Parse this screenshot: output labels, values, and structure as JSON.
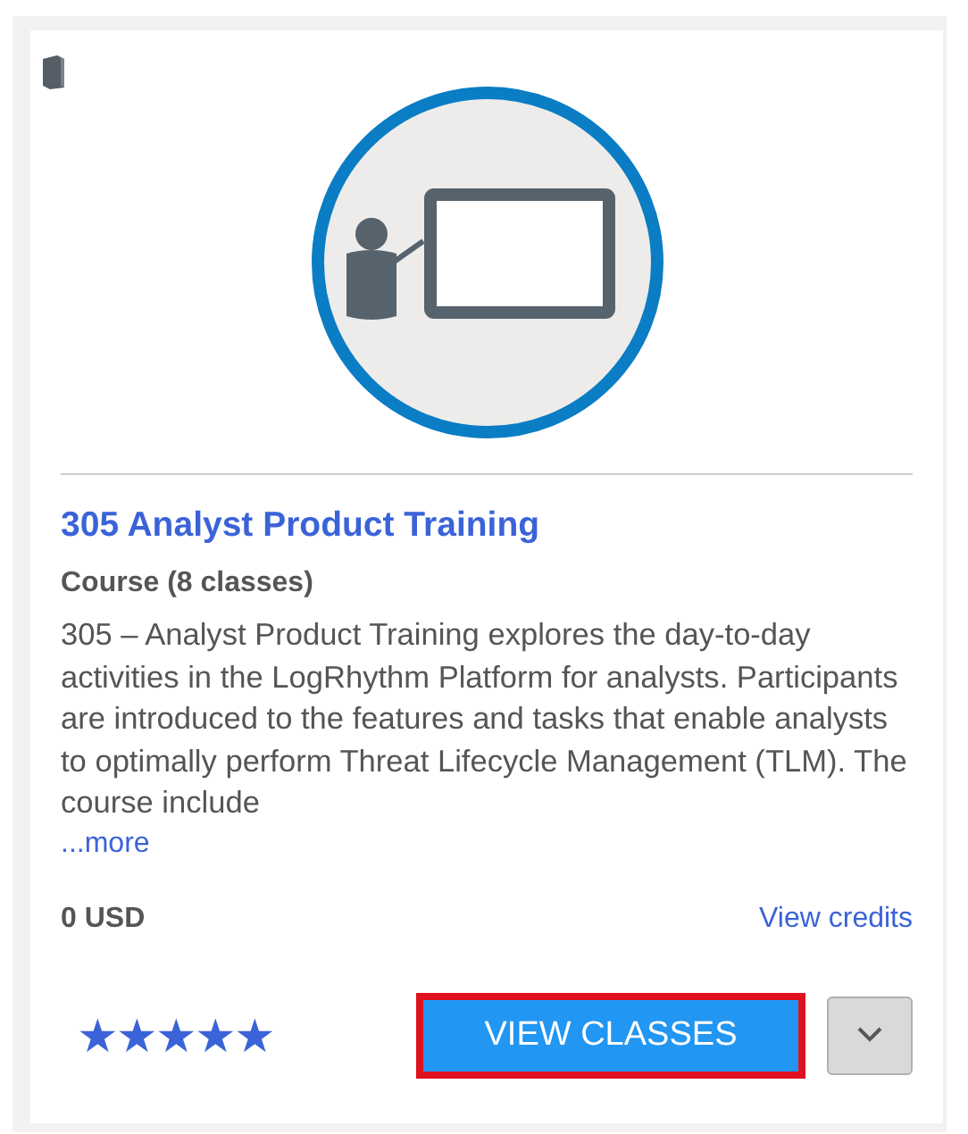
{
  "card": {
    "title": "305 Analyst Product Training",
    "subtitle": "Course (8 classes)",
    "description": "305 – Analyst Product Training explores the day-to-day activities in the LogRhythm Platform for analysts. Participants are introduced to the features and tasks that enable analysts to optimally perform Threat Lifecycle Management (TLM). The course include",
    "more_link": "...more",
    "price": "0 USD",
    "credits_link": "View credits",
    "stars": 5,
    "primary_button": {
      "label": "VIEW CLASSES",
      "highlighted": true
    }
  }
}
